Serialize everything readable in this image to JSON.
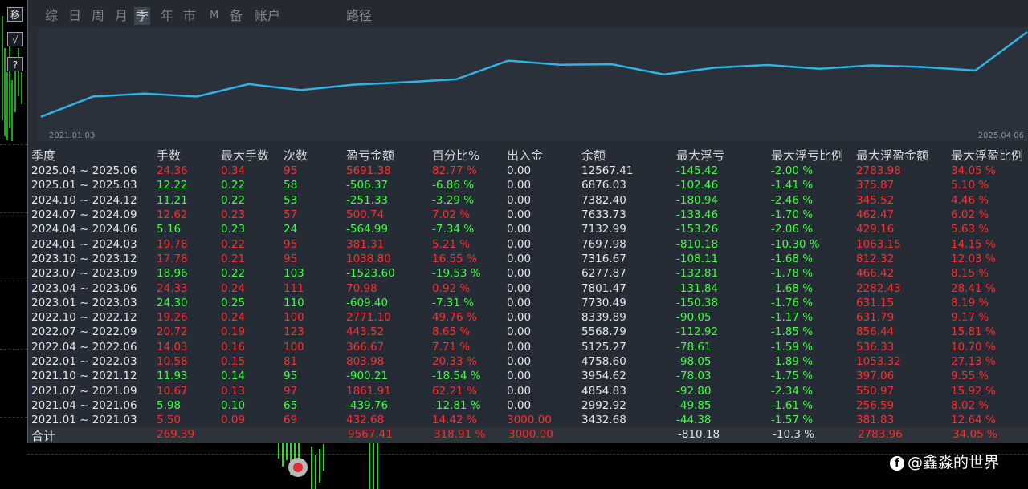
{
  "side_buttons": [
    "移",
    "√",
    "?"
  ],
  "tabs": [
    {
      "label": "综",
      "active": false
    },
    {
      "label": "日",
      "active": false
    },
    {
      "label": "周",
      "active": false
    },
    {
      "label": "月",
      "active": false
    },
    {
      "label": "季",
      "active": true
    },
    {
      "label": "年",
      "active": false
    },
    {
      "label": "市",
      "active": false
    },
    {
      "label": "M",
      "active": false
    },
    {
      "label": "备",
      "active": false
    },
    {
      "label": "账户",
      "active": false
    },
    {
      "label": "路径",
      "active": false
    }
  ],
  "chart": {
    "start_label": "2021.01·03",
    "end_label": "2025.04·06",
    "balance_series": [
      0,
      3000,
      3432.68,
      2992.92,
      4854.83,
      3954.62,
      4758.6,
      5125.27,
      5568.79,
      8339.89,
      7730.49,
      7801.47,
      6277.87,
      7316.67,
      7697.98,
      7132.99,
      7633.73,
      7382.4,
      6876.03,
      12567.41
    ],
    "line_color": "#2fb4e8"
  },
  "table": {
    "headers": [
      "季度",
      "手数",
      "最大手数",
      "次数",
      "盈亏金额",
      "百分比%",
      "出入金",
      "余额",
      "最大浮亏",
      "最大浮亏比例",
      "最大浮盈金额",
      "最大浮盈比例"
    ],
    "rows": [
      {
        "quarter": "2025.04 ~ 2025.06",
        "lots": "24.36",
        "max_lots": "0.34",
        "count": "95",
        "pnl": "5691.38",
        "pct": "82.77 %",
        "deposit": "0.00",
        "balance": "12567.41",
        "max_dd": "-145.42",
        "max_dd_pct": "-2.00 %",
        "max_fp": "2783.98",
        "max_fp_pct": "34.05 %",
        "positive": true
      },
      {
        "quarter": "2025.01 ~ 2025.03",
        "lots": "12.22",
        "max_lots": "0.22",
        "count": "58",
        "pnl": "-506.37",
        "pct": "-6.86 %",
        "deposit": "0.00",
        "balance": "6876.03",
        "max_dd": "-102.46",
        "max_dd_pct": "-1.41 %",
        "max_fp": "375.87",
        "max_fp_pct": "5.10 %",
        "positive": false
      },
      {
        "quarter": "2024.10 ~ 2024.12",
        "lots": "11.21",
        "max_lots": "0.22",
        "count": "53",
        "pnl": "-251.33",
        "pct": "-3.29 %",
        "deposit": "0.00",
        "balance": "7382.40",
        "max_dd": "-180.94",
        "max_dd_pct": "-2.46 %",
        "max_fp": "345.52",
        "max_fp_pct": "4.46 %",
        "positive": false
      },
      {
        "quarter": "2024.07 ~ 2024.09",
        "lots": "12.62",
        "max_lots": "0.23",
        "count": "57",
        "pnl": "500.74",
        "pct": "7.02 %",
        "deposit": "0.00",
        "balance": "7633.73",
        "max_dd": "-133.46",
        "max_dd_pct": "-1.70 %",
        "max_fp": "462.47",
        "max_fp_pct": "6.02 %",
        "positive": true
      },
      {
        "quarter": "2024.04 ~ 2024.06",
        "lots": "5.16",
        "max_lots": "0.23",
        "count": "24",
        "pnl": "-564.99",
        "pct": "-7.34 %",
        "deposit": "0.00",
        "balance": "7132.99",
        "max_dd": "-153.26",
        "max_dd_pct": "-2.06 %",
        "max_fp": "429.16",
        "max_fp_pct": "5.63 %",
        "positive": false
      },
      {
        "quarter": "2024.01 ~ 2024.03",
        "lots": "19.78",
        "max_lots": "0.22",
        "count": "95",
        "pnl": "381.31",
        "pct": "5.21 %",
        "deposit": "0.00",
        "balance": "7697.98",
        "max_dd": "-810.18",
        "max_dd_pct": "-10.30 %",
        "max_fp": "1063.15",
        "max_fp_pct": "14.15 %",
        "positive": true
      },
      {
        "quarter": "2023.10 ~ 2023.12",
        "lots": "17.78",
        "max_lots": "0.21",
        "count": "95",
        "pnl": "1038.80",
        "pct": "16.55 %",
        "deposit": "0.00",
        "balance": "7316.67",
        "max_dd": "-108.11",
        "max_dd_pct": "-1.68 %",
        "max_fp": "812.32",
        "max_fp_pct": "12.03 %",
        "positive": true
      },
      {
        "quarter": "2023.07 ~ 2023.09",
        "lots": "18.96",
        "max_lots": "0.22",
        "count": "103",
        "pnl": "-1523.60",
        "pct": "-19.53 %",
        "deposit": "0.00",
        "balance": "6277.87",
        "max_dd": "-132.81",
        "max_dd_pct": "-1.78 %",
        "max_fp": "466.42",
        "max_fp_pct": "8.15 %",
        "positive": false
      },
      {
        "quarter": "2023.04 ~ 2023.06",
        "lots": "24.33",
        "max_lots": "0.24",
        "count": "111",
        "pnl": "70.98",
        "pct": "0.92 %",
        "deposit": "0.00",
        "balance": "7801.47",
        "max_dd": "-131.84",
        "max_dd_pct": "-1.68 %",
        "max_fp": "2282.43",
        "max_fp_pct": "28.41 %",
        "positive": true
      },
      {
        "quarter": "2023.01 ~ 2023.03",
        "lots": "24.30",
        "max_lots": "0.25",
        "count": "110",
        "pnl": "-609.40",
        "pct": "-7.31 %",
        "deposit": "0.00",
        "balance": "7730.49",
        "max_dd": "-150.38",
        "max_dd_pct": "-1.76 %",
        "max_fp": "631.15",
        "max_fp_pct": "8.19 %",
        "positive": false
      },
      {
        "quarter": "2022.10 ~ 2022.12",
        "lots": "19.26",
        "max_lots": "0.24",
        "count": "100",
        "pnl": "2771.10",
        "pct": "49.76 %",
        "deposit": "0.00",
        "balance": "8339.89",
        "max_dd": "-90.05",
        "max_dd_pct": "-1.17 %",
        "max_fp": "631.79",
        "max_fp_pct": "9.17 %",
        "positive": true
      },
      {
        "quarter": "2022.07 ~ 2022.09",
        "lots": "20.72",
        "max_lots": "0.19",
        "count": "123",
        "pnl": "443.52",
        "pct": "8.65 %",
        "deposit": "0.00",
        "balance": "5568.79",
        "max_dd": "-112.92",
        "max_dd_pct": "-1.85 %",
        "max_fp": "856.44",
        "max_fp_pct": "15.81 %",
        "positive": true
      },
      {
        "quarter": "2022.04 ~ 2022.06",
        "lots": "14.03",
        "max_lots": "0.16",
        "count": "100",
        "pnl": "366.67",
        "pct": "7.71 %",
        "deposit": "0.00",
        "balance": "5125.27",
        "max_dd": "-78.61",
        "max_dd_pct": "-1.59 %",
        "max_fp": "536.33",
        "max_fp_pct": "10.70 %",
        "positive": true
      },
      {
        "quarter": "2022.01 ~ 2022.03",
        "lots": "10.58",
        "max_lots": "0.15",
        "count": "81",
        "pnl": "803.98",
        "pct": "20.33 %",
        "deposit": "0.00",
        "balance": "4758.60",
        "max_dd": "-98.05",
        "max_dd_pct": "-1.89 %",
        "max_fp": "1053.32",
        "max_fp_pct": "27.13 %",
        "positive": true
      },
      {
        "quarter": "2021.10 ~ 2021.12",
        "lots": "11.93",
        "max_lots": "0.14",
        "count": "95",
        "pnl": "-900.21",
        "pct": "-18.54 %",
        "deposit": "0.00",
        "balance": "3954.62",
        "max_dd": "-78.03",
        "max_dd_pct": "-1.75 %",
        "max_fp": "397.06",
        "max_fp_pct": "9.55 %",
        "positive": false
      },
      {
        "quarter": "2021.07 ~ 2021.09",
        "lots": "10.67",
        "max_lots": "0.13",
        "count": "97",
        "pnl": "1861.91",
        "pct": "62.21 %",
        "deposit": "0.00",
        "balance": "4854.83",
        "max_dd": "-92.80",
        "max_dd_pct": "-2.34 %",
        "max_fp": "550.97",
        "max_fp_pct": "15.92 %",
        "positive": true
      },
      {
        "quarter": "2021.04 ~ 2021.06",
        "lots": "5.98",
        "max_lots": "0.10",
        "count": "65",
        "pnl": "-439.76",
        "pct": "-12.81 %",
        "deposit": "0.00",
        "balance": "2992.92",
        "max_dd": "-49.85",
        "max_dd_pct": "-1.61 %",
        "max_fp": "256.59",
        "max_fp_pct": "8.02 %",
        "positive": false
      },
      {
        "quarter": "2021.01 ~ 2021.03",
        "lots": "5.50",
        "max_lots": "0.09",
        "count": "69",
        "pnl": "432.68",
        "pct": "14.42 %",
        "deposit": "3000.00",
        "balance": "3432.68",
        "max_dd": "-44.38",
        "max_dd_pct": "-1.57 %",
        "max_fp": "381.83",
        "max_fp_pct": "12.64 %",
        "positive": true
      }
    ],
    "totals": {
      "label": "合计",
      "lots": "269.39",
      "pnl": "9567.41",
      "pct": "318.91 %",
      "deposit": "3000.00",
      "max_dd": "-810.18",
      "max_dd_pct": "-10.3 %",
      "max_fp": "2783.96",
      "max_fp_pct": "34.05 %"
    }
  },
  "watermark": "@鑫淼的世界",
  "colors": {
    "positive": "#ff2c2c",
    "negative": "#3dff3d",
    "accent": "#2fb4e8"
  }
}
